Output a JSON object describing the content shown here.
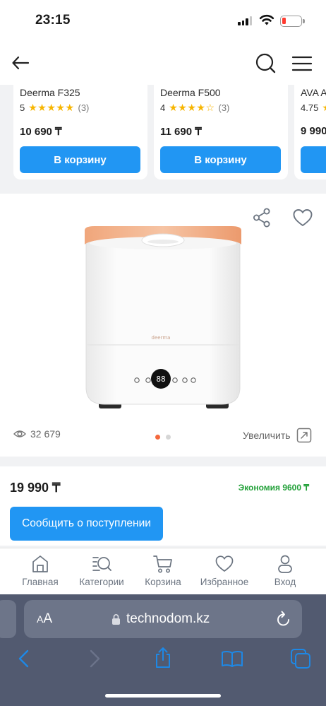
{
  "status_bar": {
    "time": "23:15"
  },
  "carousel": {
    "cart_label": "В корзину",
    "products": [
      {
        "name": "Deerma F325",
        "rating": "5",
        "stars": 5,
        "reviews": "(3)",
        "price": "10 690 ₸"
      },
      {
        "name": "Deerma F500",
        "rating": "4",
        "stars": 4,
        "reviews": "(3)",
        "price": "11 690 ₸"
      },
      {
        "name": "AVA A",
        "rating": "4.75",
        "stars": 5,
        "reviews": "",
        "price": "9 990"
      }
    ]
  },
  "gallery": {
    "views": "32 679",
    "zoom_label": "Увеличить",
    "image_count": 2,
    "active_image": 1,
    "display_digits": "88"
  },
  "price_block": {
    "price": "19 990 ₸",
    "saving": "Экономия 9600 ₸",
    "notify_label": "Сообщить о поступлении"
  },
  "tabbar": {
    "items": [
      {
        "label": "Главная",
        "icon": "home-icon"
      },
      {
        "label": "Категории",
        "icon": "categories-search-icon"
      },
      {
        "label": "Корзина",
        "icon": "cart-icon"
      },
      {
        "label": "Избранное",
        "icon": "heart-icon"
      },
      {
        "label": "Вход",
        "icon": "user-icon"
      }
    ]
  },
  "browser": {
    "text_size_label": "AA",
    "url": "technodom.kz"
  },
  "colors": {
    "accent_blue": "#2196f3",
    "saving_green": "#21a038",
    "star_yellow": "#f7b500",
    "dot_active": "#f4683c",
    "dot_inactive": "#d6d6d6",
    "safari_bar": "#525a70",
    "safari_nav_icon": "#1e88e5"
  }
}
